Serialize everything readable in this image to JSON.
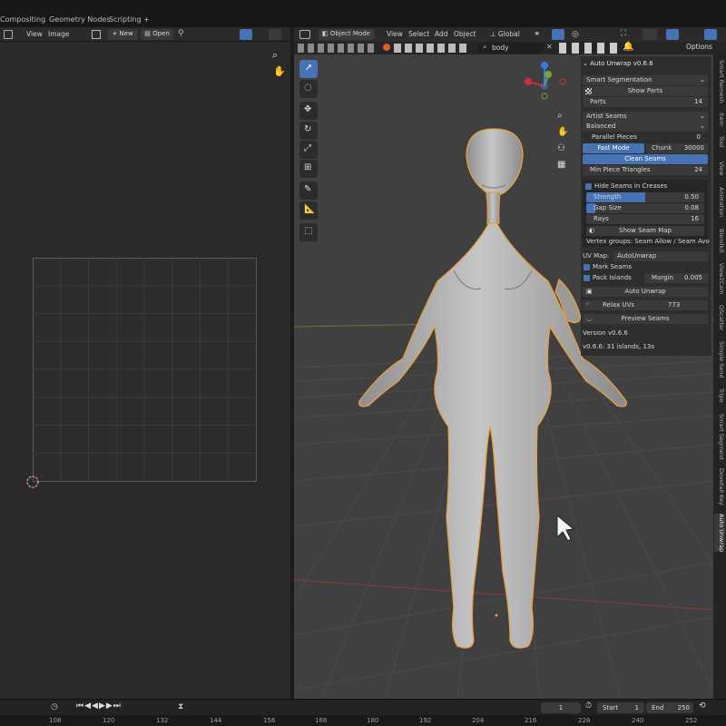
{
  "workspace_tabs": [
    "Compositing",
    "Geometry Nodes",
    "Scripting",
    "+"
  ],
  "uv_editor": {
    "menus": [
      "View",
      "Image"
    ],
    "new_label": "New",
    "open_label": "Open"
  },
  "viewport_header": {
    "mode": "Object Mode",
    "menus": [
      "View",
      "Select",
      "Add",
      "Object"
    ],
    "orientation": "Global",
    "search_value": "body",
    "options_label": "Options"
  },
  "addon_panel": {
    "title": "Auto Unwrap v0.6.6",
    "segmentation_mode": "Smart Segmentation",
    "show_parts": "Show Parts",
    "parts_label": "Parts",
    "parts_value": "14",
    "seam_mode": "Artist Seams",
    "quality": "Balanced",
    "parallel_pieces_label": "Parallel Pieces",
    "parallel_pieces_value": "0",
    "fast_mode": "Fast Mode",
    "chunk_label": "Chunk",
    "chunk_value": "30000",
    "clean_seams": "Clean Seams",
    "min_piece_label": "Min Piece Triangles",
    "min_piece_value": "24",
    "hide_seams": "Hide Seams in Creases",
    "strength_label": "Strength",
    "strength_value": "0.50",
    "gap_label": "Gap Size",
    "gap_value": "0.08",
    "rays_label": "Rays",
    "rays_value": "16",
    "show_seam_map": "Show Seam Map",
    "vertex_groups": "Vertex groups: Seam Allow / Seam Avoid",
    "uv_map_label": "UV Map:",
    "uv_map_value": "AutoUnwrap",
    "mark_seams": "Mark Seams",
    "pack_islands": "Pack Islands",
    "margin_label": "Margin",
    "margin_value": "0.005",
    "auto_unwrap": "Auto Unwrap",
    "relax_label": "Relax UVs",
    "relax_value": "773",
    "preview_seams": "Preview Seams",
    "version": "Version v0.6.6",
    "result": "v0.6.6: 31 islands, 13s",
    "strength_fraction": 0.5,
    "gap_fraction": 0.08
  },
  "sidebar_tabs": [
    "Smart Remesh",
    "Item",
    "Tool",
    "View",
    "Animation",
    "Blendkit",
    "View2Cam",
    "QScatter",
    "Simple Send",
    "Tripo",
    "Smart Segment",
    "Dovetail Key",
    "Auto Unwrap"
  ],
  "timeline": {
    "current_frame": "1",
    "start_label": "Start",
    "start_value": "1",
    "end_label": "End",
    "end_value": "250"
  },
  "ruler_numbers": [
    "108",
    "120",
    "132",
    "144",
    "156",
    "168",
    "180",
    "192",
    "204",
    "216",
    "228",
    "240",
    "252"
  ],
  "colors": {
    "accent": "#4772b3",
    "selection_outline": "#e8a03a",
    "x_axis": "#c8323c",
    "y_axis": "#6fa83a",
    "z_axis": "#3a7ae0"
  }
}
